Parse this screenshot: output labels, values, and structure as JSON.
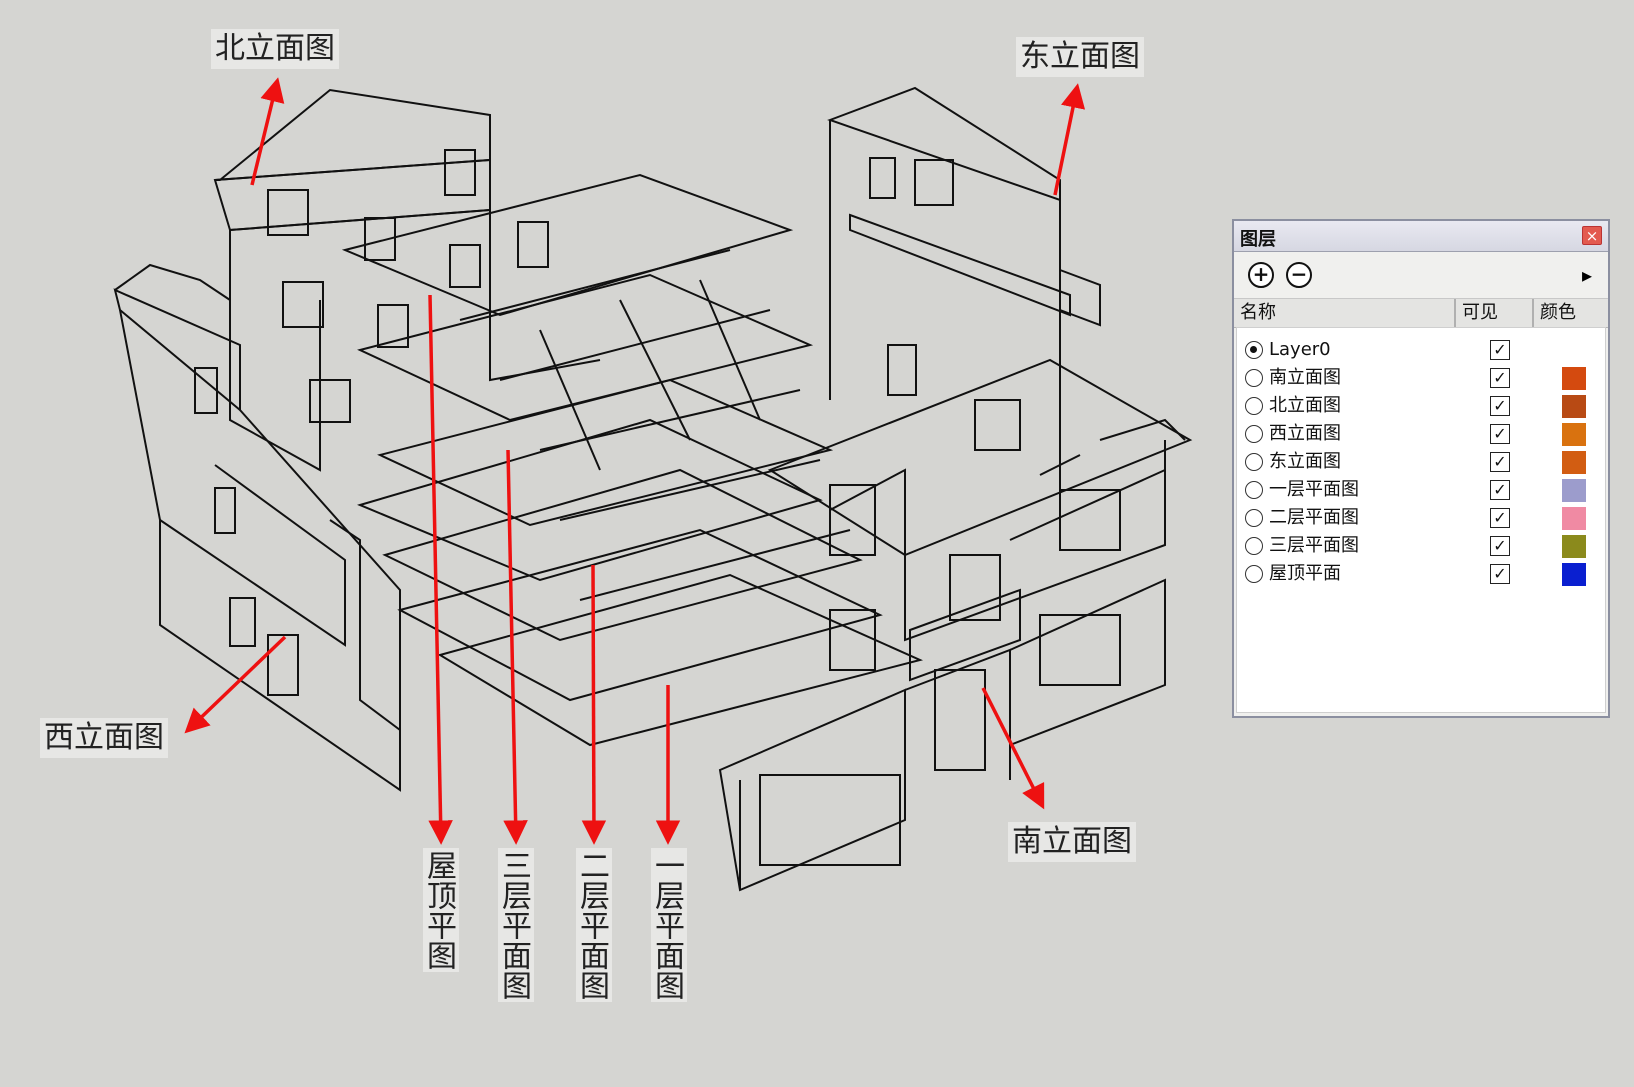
{
  "callouts": {
    "north": "北立面图",
    "east": "东立面图",
    "west": "西立面图",
    "south": "南立面图",
    "roof": "屋顶平图",
    "floor3": "三层平面图",
    "floor2": "二层平面图",
    "floor1": "一层平面图"
  },
  "panel": {
    "title": "图层",
    "close_icon": "×",
    "add_icon": "+",
    "remove_icon": "−",
    "details_icon": "▸",
    "columns": {
      "name": "名称",
      "visible": "可见",
      "color": "颜色"
    },
    "layers": [
      {
        "name": "Layer0",
        "active": true,
        "visible": true,
        "color": ""
      },
      {
        "name": "南立面图",
        "active": false,
        "visible": true,
        "color": "#d44a0f"
      },
      {
        "name": "北立面图",
        "active": false,
        "visible": true,
        "color": "#b84a14"
      },
      {
        "name": "西立面图",
        "active": false,
        "visible": true,
        "color": "#d9720f"
      },
      {
        "name": "东立面图",
        "active": false,
        "visible": true,
        "color": "#d25d12"
      },
      {
        "name": "一层平面图",
        "active": false,
        "visible": true,
        "color": "#9c9ccc"
      },
      {
        "name": "二层平面图",
        "active": false,
        "visible": true,
        "color": "#f08aa3"
      },
      {
        "name": "三层平面图",
        "active": false,
        "visible": true,
        "color": "#8b8a1c"
      },
      {
        "name": "屋顶平面",
        "active": false,
        "visible": true,
        "color": "#0a1fd0"
      }
    ]
  },
  "colors": {
    "arrow": "#ee1111",
    "linework": "#111111"
  }
}
